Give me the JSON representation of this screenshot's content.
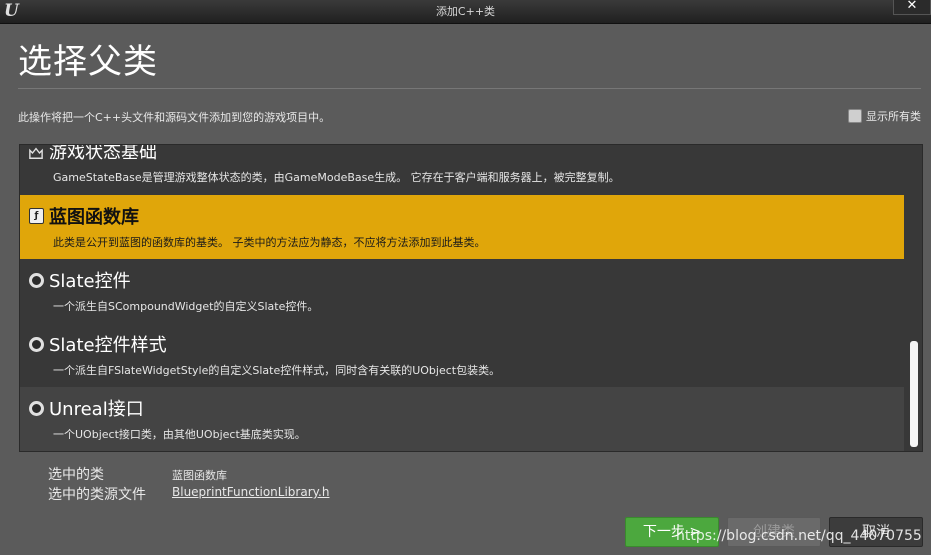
{
  "window": {
    "logo": "U",
    "title": "添加C++类",
    "close": "✕"
  },
  "page": {
    "heading": "选择父类",
    "description": "此操作将把一个C++头文件和源码文件添加到您的游戏项目中。",
    "show_all_label": "显示所有类",
    "show_all_checked": false
  },
  "list": {
    "items": [
      {
        "name": "游戏状态基础",
        "desc": "GameStateBase是管理游戏整体状态的类，由GameModeBase生成。 它存在于客户端和服务器上，被完整复制。",
        "icon": "game-state-icon"
      },
      {
        "name": "蓝图函数库",
        "desc": "此类是公开到蓝图的函数库的基类。 子类中的方法应为静态，不应将方法添加到此基类。",
        "icon": "blueprint-library-icon",
        "selected": true
      },
      {
        "name": "Slate控件",
        "desc": "一个派生自SCompoundWidget的自定义Slate控件。",
        "icon": "radio-icon"
      },
      {
        "name": "Slate控件样式",
        "desc": "一个派生自FSlateWidgetStyle的自定义Slate控件样式，同时含有关联的UObject包装类。",
        "icon": "radio-icon"
      },
      {
        "name": "Unreal接口",
        "desc": "一个UObject接口类，由其他UObject基底类实现。",
        "icon": "radio-icon"
      }
    ]
  },
  "selection": {
    "class_label": "选中的类",
    "class_value": "蓝图函数库",
    "source_label": "选中的类源文件",
    "source_value": "BlueprintFunctionLibrary.h"
  },
  "buttons": {
    "next": "下一步 >",
    "create": "创建类",
    "cancel": "取消"
  },
  "watermark": "https://blog.csdn.net/qq_44070755",
  "colors": {
    "selected_row": "#e0a60a",
    "next_button": "#4ca83e"
  }
}
